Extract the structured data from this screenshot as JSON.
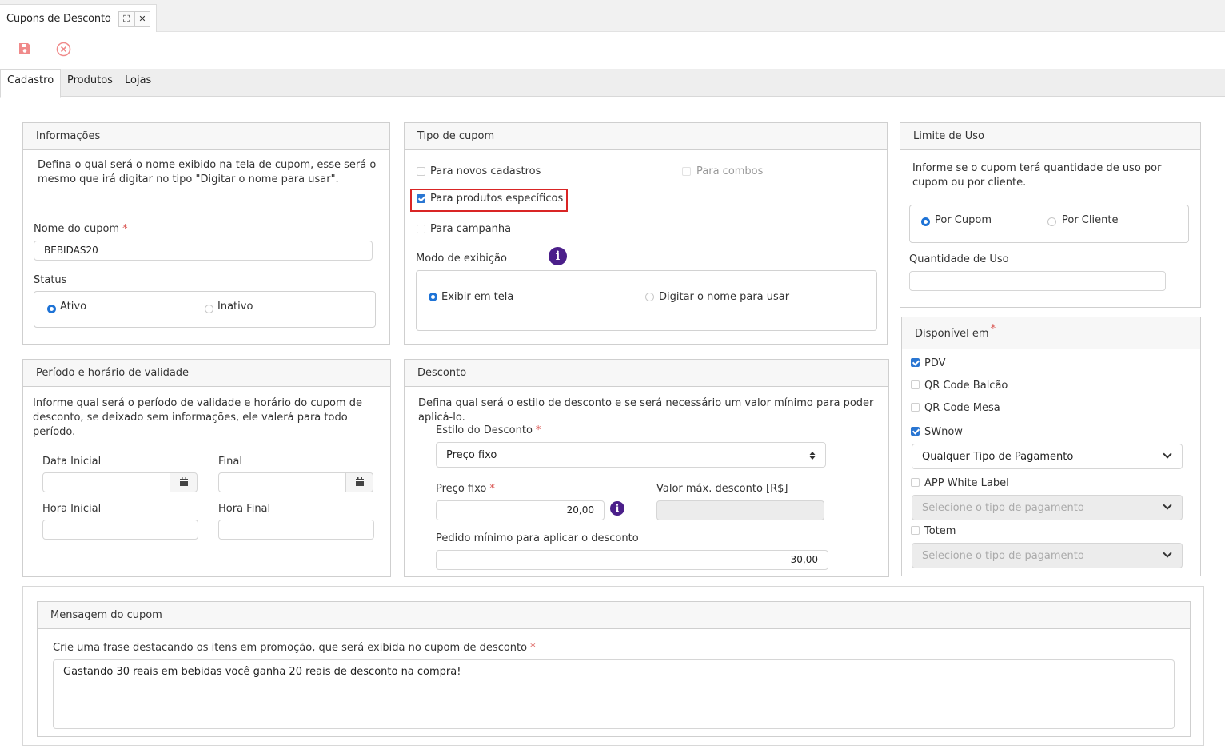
{
  "window": {
    "title": "Cupons de Desconto",
    "expand_glyph": "⛶",
    "close_glyph": "✕"
  },
  "toolbar": {
    "save_icon": "save-icon",
    "cancel_icon": "cancel-circle-icon",
    "icon_color": "#f08a8a"
  },
  "tabs": [
    {
      "label": "Cadastro",
      "active": true
    },
    {
      "label": "Produtos",
      "active": false
    },
    {
      "label": "Lojas",
      "active": false
    }
  ],
  "informacoes": {
    "title": "Informações",
    "description": "Defina o qual será o nome exibido na tela de cupom, esse será o mesmo que irá digitar no tipo \"Digitar o nome para usar\".",
    "nome_label": "Nome do cupom",
    "nome_value": "BEBIDAS20",
    "status_label": "Status",
    "status_options": [
      "Ativo",
      "Inativo"
    ],
    "status_selected": "Ativo"
  },
  "tipo_cupom": {
    "title": "Tipo de cupom",
    "options": [
      {
        "label": "Para novos cadastros",
        "checked": false
      },
      {
        "label": "Para combos",
        "checked": false,
        "disabled": true
      },
      {
        "label": "Para produtos específicos",
        "checked": true
      },
      {
        "label": "Para campanha",
        "checked": false
      }
    ],
    "modo_label": "Modo de exibição",
    "modo_options": [
      "Exibir em tela",
      "Digitar o nome para usar"
    ],
    "modo_selected": "Exibir em tela"
  },
  "limite_uso": {
    "title": "Limite de Uso",
    "description": "Informe se o cupom terá quantidade de uso por cupom ou por cliente.",
    "options": [
      "Por Cupom",
      "Por Cliente"
    ],
    "selected": "Por Cupom",
    "quantidade_label": "Quantidade de Uso",
    "quantidade_value": ""
  },
  "disponivel": {
    "title": "Disponível em",
    "items": [
      {
        "label": "PDV",
        "checked": true
      },
      {
        "label": "QR Code Balcão",
        "checked": false
      },
      {
        "label": "QR Code Mesa",
        "checked": false
      },
      {
        "label": "SWnow",
        "checked": true
      },
      {
        "label": "APP White Label",
        "checked": false
      },
      {
        "label": "Totem",
        "checked": false
      }
    ],
    "swnow_payment": "Qualquer Tipo de Pagamento",
    "app_payment_placeholder": "Selecione o tipo de pagamento",
    "totem_payment_placeholder": "Selecione o tipo de pagamento"
  },
  "periodo": {
    "title": "Período e horário de validade",
    "description": "Informe qual será o período de validade e horário do cupom de desconto, se deixado sem informações, ele valerá para todo período.",
    "data_inicial_label": "Data Inicial",
    "final_label": "Final",
    "hora_inicial_label": "Hora Inicial",
    "hora_final_label": "Hora Final"
  },
  "desconto": {
    "title": "Desconto",
    "description": "Defina qual será o estilo de desconto e se será necessário um valor mínimo para poder aplicá-lo.",
    "estilo_label": "Estilo do Desconto",
    "estilo_value": "Preço fixo",
    "preco_label": "Preço fixo",
    "preco_value": "20,00",
    "valor_max_label": "Valor máx. desconto [R$]",
    "valor_max_value": "",
    "pedido_label": "Pedido mínimo para aplicar o desconto",
    "pedido_value": "30,00"
  },
  "mensagem": {
    "title": "Mensagem do cupom",
    "label": "Crie uma frase destacando os itens em promoção, que será exibida no cupom de desconto",
    "value": "Gastando 30 reais em bebidas você ganha 20 reais de desconto na compra!"
  },
  "colors": {
    "accent": "#1e73d6",
    "required": "#d9534f",
    "info": "#4b1f8a",
    "highlight": "#d92525"
  }
}
